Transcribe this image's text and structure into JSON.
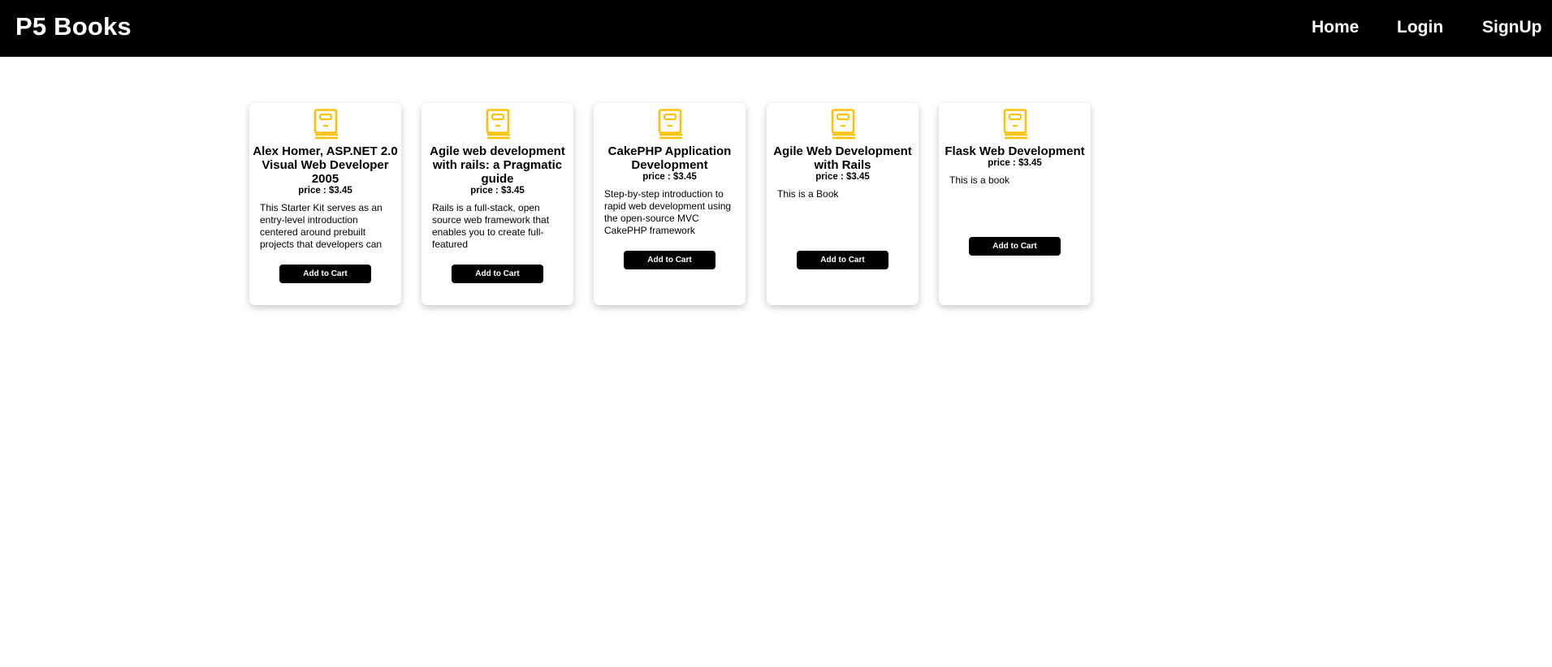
{
  "app": {
    "brand": "P5 Books"
  },
  "nav": {
    "home": "Home",
    "login": "Login",
    "signup": "SignUp"
  },
  "colors": {
    "navbar_bg": "#000000",
    "icon_accent": "#FFC107",
    "button_bg": "#000000"
  },
  "books": [
    {
      "icon": "book-icon",
      "title": "Alex Homer, ASP.NET 2.0 Visual Web Developer 2005",
      "price": "price : $3.45",
      "description": "This Starter Kit serves as an entry-level introduction centered around prebuilt projects that developers can",
      "button": "Add to Cart"
    },
    {
      "icon": "book-icon",
      "title": "Agile web development with rails: a Pragmatic guide",
      "price": "price : $3.45",
      "description": "Rails is a full-stack, open source web framework that enables you to create full-featured",
      "button": "Add to Cart"
    },
    {
      "icon": "book-icon",
      "title": "CakePHP Application Development",
      "price": "price : $3.45",
      "description": "Step-by-step introduction to rapid web development using the open-source MVC CakePHP framework",
      "button": "Add to Cart"
    },
    {
      "icon": "book-icon",
      "title": "Agile Web Development with Rails",
      "price": "price : $3.45",
      "description": "This is a Book",
      "button": "Add to Cart"
    },
    {
      "icon": "book-icon",
      "title": "Flask Web Development",
      "price": "price : $3.45",
      "description": "This is a book",
      "button": "Add to Cart"
    }
  ]
}
